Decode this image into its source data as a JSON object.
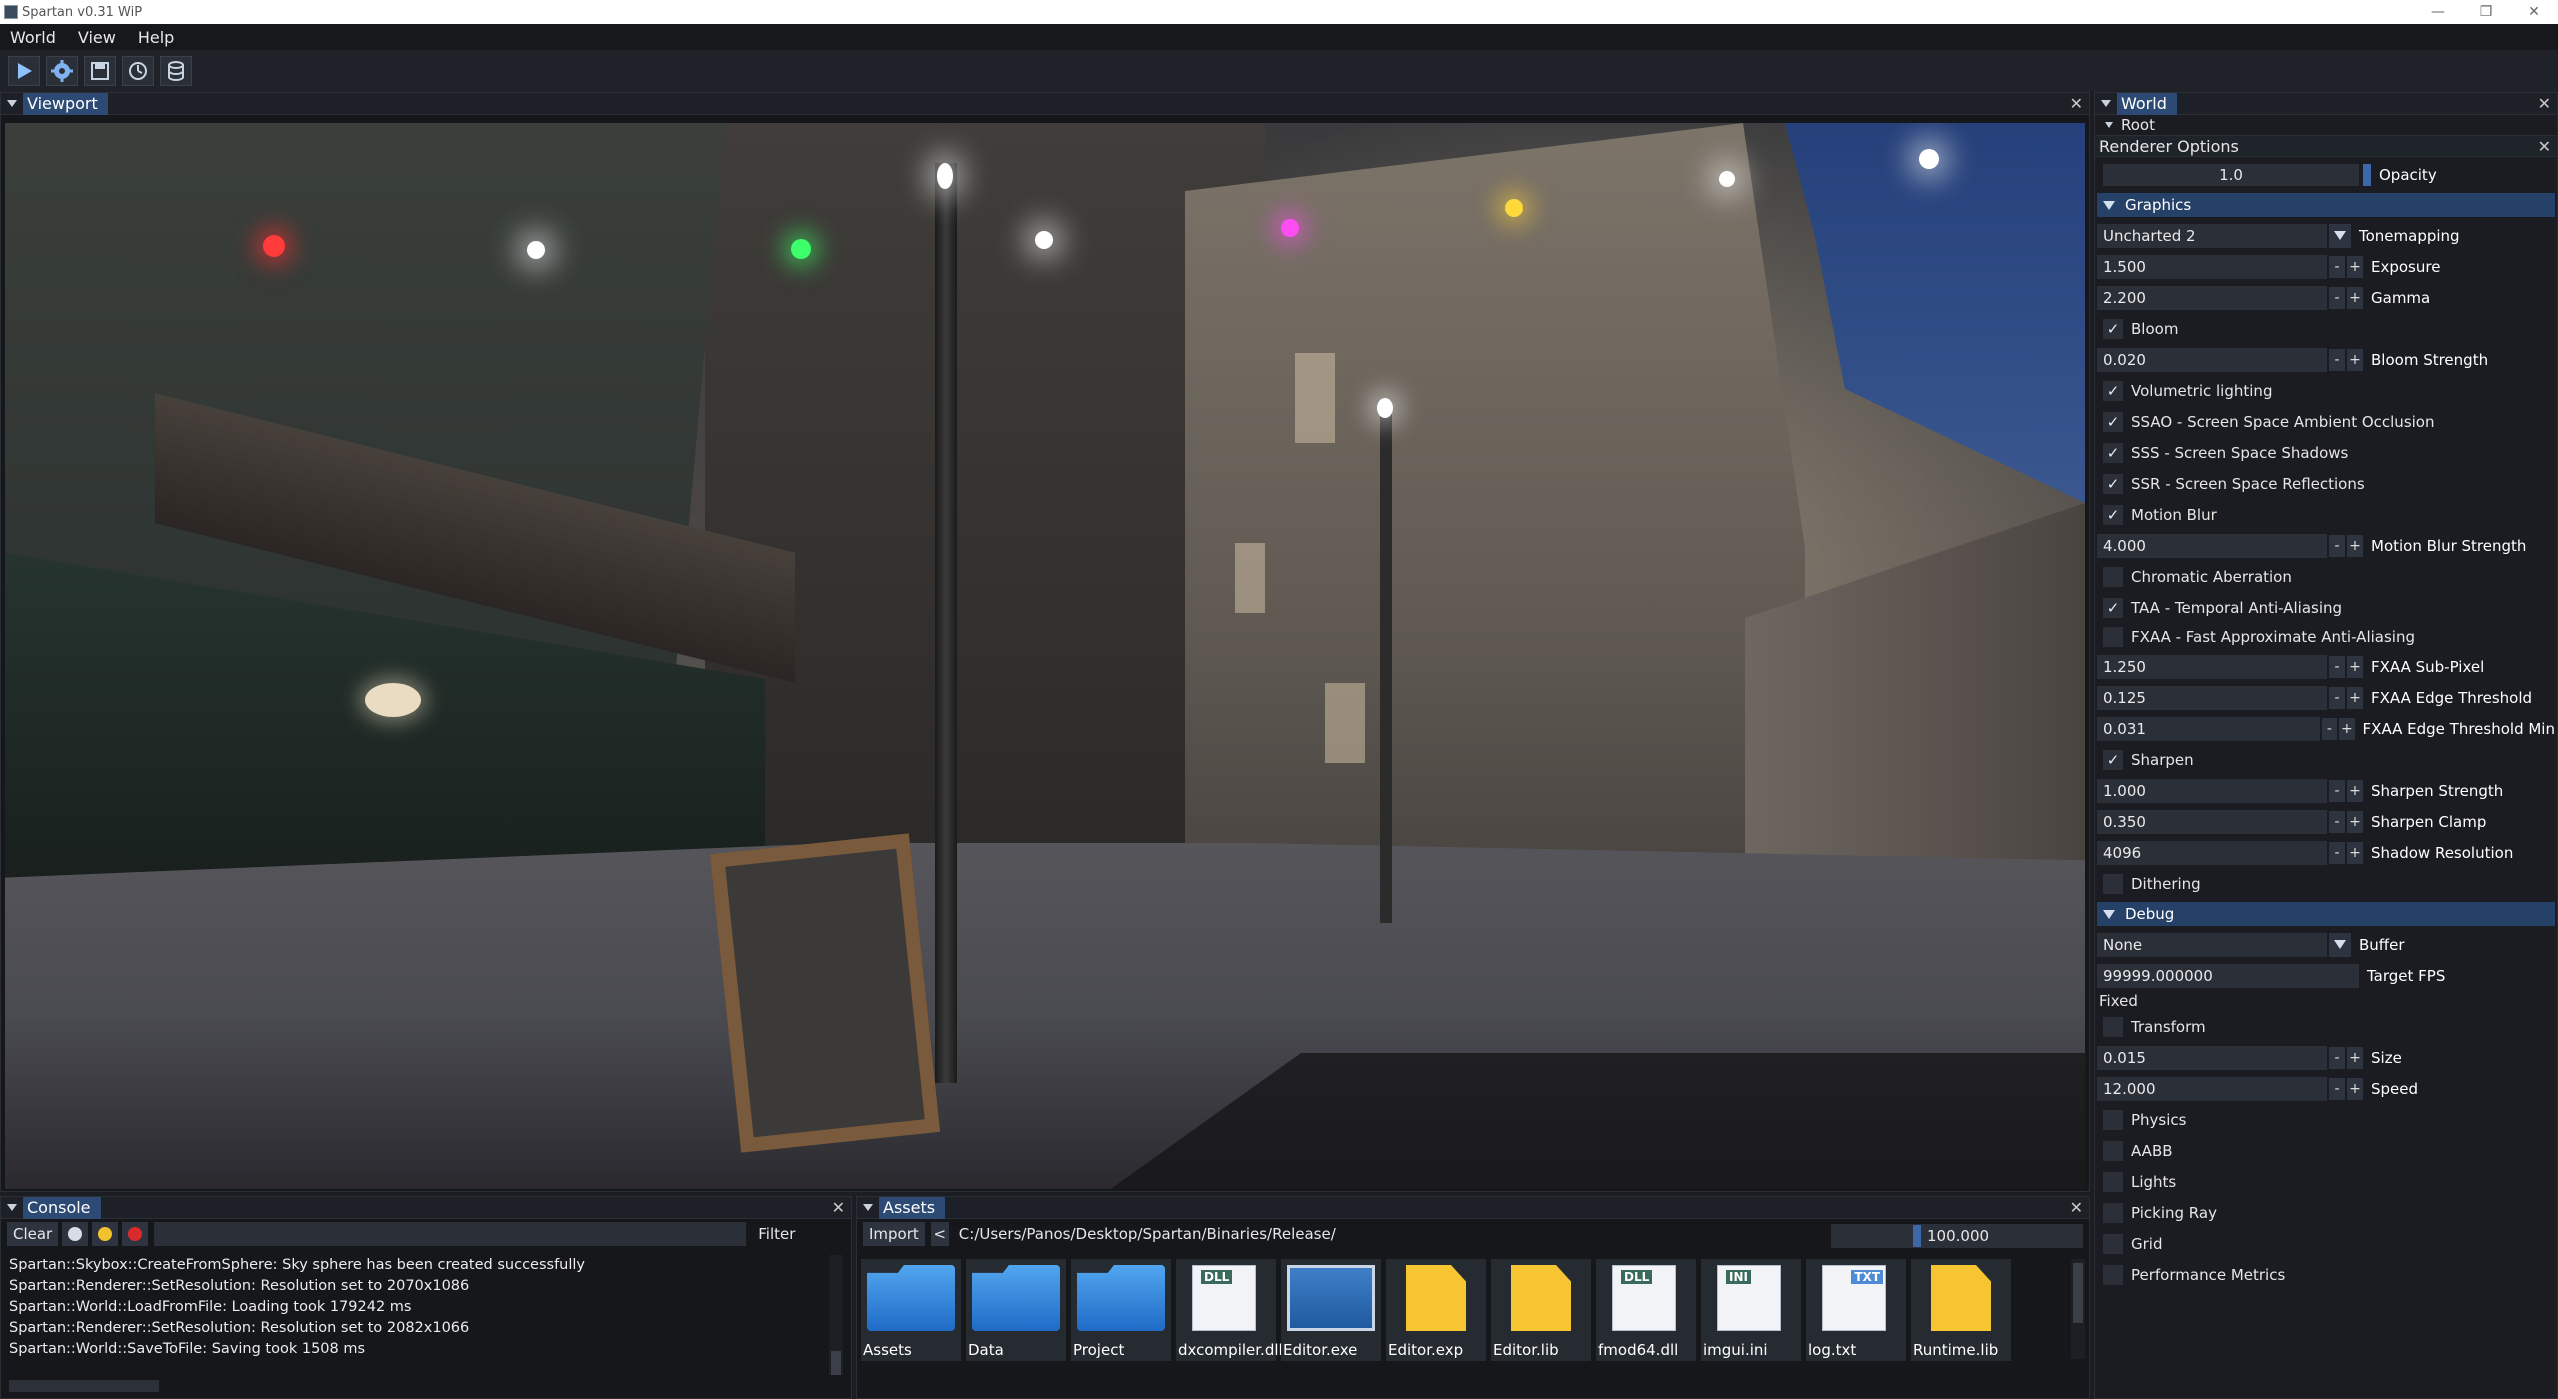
{
  "window": {
    "title": "Spartan v0.31 WiP",
    "controls": [
      "—",
      "❐",
      "✕"
    ]
  },
  "menu": [
    "World",
    "View",
    "Help"
  ],
  "toolbar": {
    "buttons": [
      "play-icon",
      "settings-icon",
      "save-icon",
      "profiler-icon",
      "resource-cache-icon"
    ]
  },
  "viewport": {
    "title": "Viewport",
    "close": "✕"
  },
  "world": {
    "title": "World",
    "close": "✕",
    "root_label": "Root"
  },
  "renderer_options": {
    "title": "Renderer Options",
    "close": "✕",
    "opacity_value": "1.0",
    "opacity_label": "Opacity",
    "graphics_header": "Graphics",
    "tonemapping_value": "Uncharted 2",
    "tonemapping_label": "Tonemapping",
    "exposure_value": "1.500",
    "exposure_label": "Exposure",
    "gamma_value": "2.200",
    "gamma_label": "Gamma",
    "bloom_label": "Bloom",
    "bloom_checked": true,
    "bloom_strength_value": "0.020",
    "bloom_strength_label": "Bloom Strength",
    "volumetric_label": "Volumetric lighting",
    "volumetric_checked": true,
    "ssao_label": "SSAO - Screen Space Ambient Occlusion",
    "ssao_checked": true,
    "sss_label": "SSS - Screen Space Shadows",
    "sss_checked": true,
    "ssr_label": "SSR - Screen Space Reflections",
    "ssr_checked": true,
    "motion_blur_label": "Motion Blur",
    "motion_blur_checked": true,
    "motion_blur_strength_value": "4.000",
    "motion_blur_strength_label": "Motion Blur Strength",
    "chromatic_label": "Chromatic Aberration",
    "chromatic_checked": false,
    "taa_label": "TAA - Temporal Anti-Aliasing",
    "taa_checked": true,
    "fxaa_label": "FXAA - Fast Approximate Anti-Aliasing",
    "fxaa_checked": false,
    "fxaa_subpixel_value": "1.250",
    "fxaa_subpixel_label": "FXAA Sub-Pixel",
    "fxaa_edge_value": "0.125",
    "fxaa_edge_label": "FXAA Edge Threshold",
    "fxaa_edge_min_value": "0.031",
    "fxaa_edge_min_label": "FXAA Edge Threshold Min",
    "sharpen_label": "Sharpen",
    "sharpen_checked": true,
    "sharpen_strength_value": "1.000",
    "sharpen_strength_label": "Sharpen Strength",
    "sharpen_clamp_value": "0.350",
    "sharpen_clamp_label": "Sharpen Clamp",
    "shadow_res_value": "4096",
    "shadow_res_label": "Shadow Resolution",
    "dithering_label": "Dithering",
    "dithering_checked": false,
    "debug_header": "Debug",
    "buffer_value": "None",
    "buffer_label": "Buffer",
    "target_fps_value": "99999.000000",
    "target_fps_label": "Target FPS",
    "fixed_label": "Fixed",
    "transform_label": "Transform",
    "transform_checked": false,
    "size_value": "0.015",
    "size_label": "Size",
    "speed_value": "12.000",
    "speed_label": "Speed",
    "physics_label": "Physics",
    "aabb_label": "AABB",
    "lights_label": "Lights",
    "picking_ray_label": "Picking Ray",
    "grid_label": "Grid",
    "perf_metrics_label": "Performance Metrics",
    "minus": "-",
    "plus": "+",
    "check_mark": "✓"
  },
  "console": {
    "title": "Console",
    "close": "✕",
    "clear_label": "Clear",
    "filter_label": "Filter",
    "filter_value": "",
    "lines": [
      "Spartan::Skybox::CreateFromSphere: Sky sphere has been created successfully",
      "Spartan::Renderer::SetResolution: Resolution set to 2070x1086",
      "Spartan::World::LoadFromFile: Loading took 179242 ms",
      "Spartan::Renderer::SetResolution: Resolution set to 2082x1066",
      "Spartan::World::SaveToFile: Saving took 1508 ms"
    ],
    "colors": {
      "info": "#d8dde5",
      "warning": "#f2c12e",
      "error": "#d92b2b"
    }
  },
  "assets": {
    "title": "Assets",
    "close": "✕",
    "import_label": "Import",
    "back_label": "<",
    "path": "C:/Users/Panos/Desktop/Spartan/Binaries/Release/",
    "zoom_value": "100.000",
    "items": [
      {
        "name": "Assets",
        "type": "folder"
      },
      {
        "name": "Data",
        "type": "folder"
      },
      {
        "name": "Project",
        "type": "folder"
      },
      {
        "name": "dxcompiler.dll",
        "type": "dll",
        "badge": "DLL"
      },
      {
        "name": "Editor.exe",
        "type": "exe"
      },
      {
        "name": "Editor.exp",
        "type": "file"
      },
      {
        "name": "Editor.lib",
        "type": "file"
      },
      {
        "name": "fmod64.dll",
        "type": "dll",
        "badge": "DLL"
      },
      {
        "name": "imgui.ini",
        "type": "ini",
        "badge": "INI"
      },
      {
        "name": "log.txt",
        "type": "txt",
        "badge": "TXT"
      },
      {
        "name": "Runtime.lib",
        "type": "file"
      }
    ]
  },
  "theme": {
    "accent": "#264167",
    "tab_active": "#2d4a75",
    "slider_grip": "#3c67a8"
  }
}
